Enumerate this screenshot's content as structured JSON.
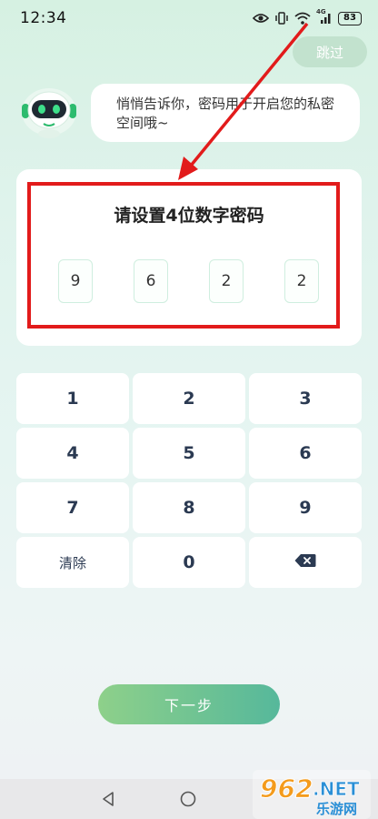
{
  "status_bar": {
    "time": "12:34",
    "network_label": "4G",
    "battery": "83"
  },
  "header": {
    "skip_label": "跳过"
  },
  "assistant": {
    "message": "悄悄告诉你，密码用于开启您的私密空间哦~"
  },
  "pin_setup": {
    "title": "请设置4位数字密码",
    "digits": [
      "9",
      "6",
      "2",
      "2"
    ]
  },
  "keypad": {
    "keys": [
      "1",
      "2",
      "3",
      "4",
      "5",
      "6",
      "7",
      "8",
      "9",
      "清除",
      "0",
      "backspace"
    ]
  },
  "footer": {
    "next_label": "下一步"
  },
  "watermark": {
    "brand": "962",
    "suffix": ".NET",
    "caption": "乐游网"
  },
  "colors": {
    "accent_green": "#6fc393",
    "annotation_red": "#e21b1b",
    "key_text": "#2b3a52"
  }
}
